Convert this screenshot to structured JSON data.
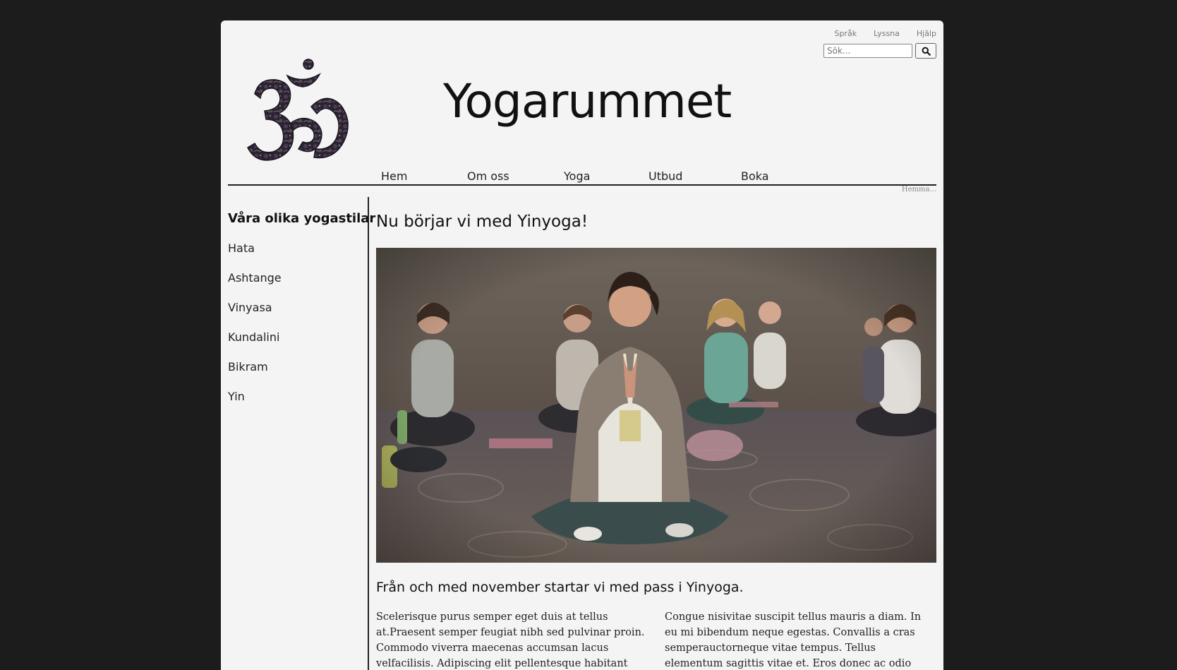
{
  "util_links": [
    "Språk",
    "Lyssna",
    "Hjälp"
  ],
  "search": {
    "placeholder": "Sök..."
  },
  "site": {
    "title": "Yogarummet"
  },
  "nav": [
    "Hem",
    "Om oss",
    "Yoga",
    "Utbud",
    "Boka"
  ],
  "breadcrumb": "Hemma...",
  "sidebar": {
    "heading": "Våra olika yogastilar",
    "items": [
      "Hata",
      "Ashtange",
      "Vinyasa",
      "Kundalini",
      "Bikram",
      "Yin"
    ]
  },
  "main": {
    "heading": "Nu börjar vi med Yinyoga!",
    "subheading": "Från och med november startar vi med pass i Yinyoga.",
    "col1": "Scelerisque purus semper eget duis at tellus at.Praesent semper feugiat nibh sed pulvinar proin. Commodo viverra maecenas accumsan lacus velfacilisis. Adipiscing elit pellentesque habitant morbi. Eget arcu dictum varius duis at consectetur lorem.",
    "col2": "Congue nisivitae suscipit tellus mauris a diam. In eu mi bibendum neque egestas. Convallis a cras semperauctorneque vitae tempus. Tellus elementum sagittis vitae et. Eros donec ac odio tempor. Vitae congue mauris rhoncus aenean."
  }
}
